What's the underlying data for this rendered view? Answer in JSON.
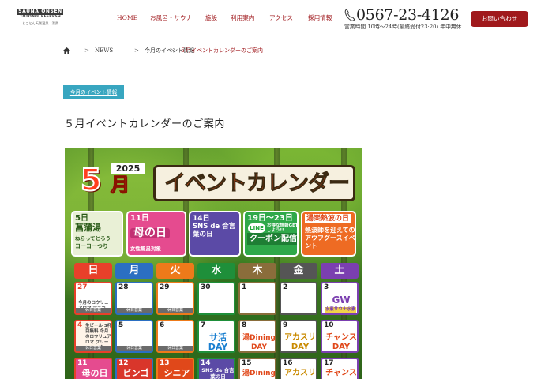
{
  "site": {
    "logo_line1": "SAUNA ONSEN",
    "logo_line2": "TOTONOI REFRESH",
    "logo_line3": "とことん天然温泉　湯楽"
  },
  "nav": {
    "items": [
      {
        "label": "HOME"
      },
      {
        "label": "お風呂・サウナ"
      },
      {
        "label": "施設"
      },
      {
        "label": "利用案内"
      },
      {
        "label": "アクセス"
      },
      {
        "label": "採用情報"
      }
    ]
  },
  "header": {
    "phone": "0567-23-4126",
    "hours": "営業時間 10時～24時(最終受付23:20)  年中無休",
    "contact_label": "お問い合わせ"
  },
  "breadcrumb": {
    "items": [
      {
        "label": "NEWS"
      },
      {
        "label": "今月のイベント情報"
      },
      {
        "label": "５月イベントカレンダーのご案内"
      }
    ],
    "separator": ">"
  },
  "post": {
    "category": "今月のイベント情報",
    "title": "５月イベントカレンダーのご案内"
  },
  "poster": {
    "month_number": "5",
    "month_kanji": "月",
    "year": "2025",
    "banner": "イベントカレンダー",
    "events": [
      {
        "date": "5日",
        "title": "菖蒲湯",
        "sub": "ねらってとろう",
        "sub2": "ヨーヨーつり"
      },
      {
        "date": "11日",
        "title": "母の日",
        "sub": "女性風呂対象"
      },
      {
        "date": "14日",
        "title": "SNS de 合言葉の日",
        "sub": ""
      },
      {
        "date": "19日～23日",
        "title": "クーポン配信",
        "badge": "LINE",
        "sub": "お得な情報GETしよう!!"
      },
      {
        "date": "湯楽熱波の日",
        "title": "熱波師を迎えてのアウフグースイベント",
        "sub": ""
      }
    ],
    "weekdays": [
      {
        "label": "日",
        "color": "#e8402a"
      },
      {
        "label": "月",
        "color": "#2b6fc2"
      },
      {
        "label": "火",
        "color": "#ee7a1a"
      },
      {
        "label": "水",
        "color": "#1e8f3a"
      },
      {
        "label": "木",
        "color": "#8a6d3b"
      },
      {
        "label": "金",
        "color": "#555555"
      },
      {
        "label": "土",
        "color": "#7b3fb0"
      }
    ],
    "week1": [
      {
        "d": "27",
        "note": "今月のロウリュアロマ マスカット",
        "strip": "休日営業"
      },
      {
        "d": "28",
        "note": "",
        "strip": "休日営業"
      },
      {
        "d": "29",
        "note": "",
        "strip": "休日営業"
      },
      {
        "d": "30",
        "note": "",
        "strip": ""
      },
      {
        "d": "1",
        "note": "",
        "strip": ""
      },
      {
        "d": "2",
        "note": "",
        "strip": ""
      },
      {
        "d": "3",
        "big": "GW",
        "sub": "水素サウナ水素",
        "strip": ""
      }
    ],
    "week2": [
      {
        "d": "4",
        "note": "生ビール 3杯目無料 今月のロウリュアロマ グリーンハーブ",
        "strip": "休日営業"
      },
      {
        "d": "5",
        "note": "",
        "strip": "休日営業"
      },
      {
        "d": "6",
        "note": "",
        "strip": "休日営業"
      },
      {
        "d": "7",
        "big": "サ活 DAY",
        "strip": ""
      },
      {
        "d": "8",
        "big": "湯Dining DAY",
        "strip": ""
      },
      {
        "d": "9",
        "big": "アカスリ DAY",
        "strip": ""
      },
      {
        "d": "10",
        "big": "チャンス DAY",
        "strip": ""
      }
    ],
    "week3": [
      {
        "d": "11",
        "big": "母の日"
      },
      {
        "d": "12",
        "big": "ビンゴ"
      },
      {
        "d": "13",
        "big": "シニア"
      },
      {
        "d": "14",
        "big": "SNS de 合言葉の日"
      },
      {
        "d": "15",
        "big": "湯Dining"
      },
      {
        "d": "16",
        "big": "アカスリ"
      },
      {
        "d": "17",
        "big": "チャンス"
      }
    ]
  },
  "colors": {
    "brand_red": "#a0191c",
    "accent_blue": "#38a6c0"
  },
  "icons": {
    "phone": "phone-icon",
    "home": "home-icon"
  }
}
